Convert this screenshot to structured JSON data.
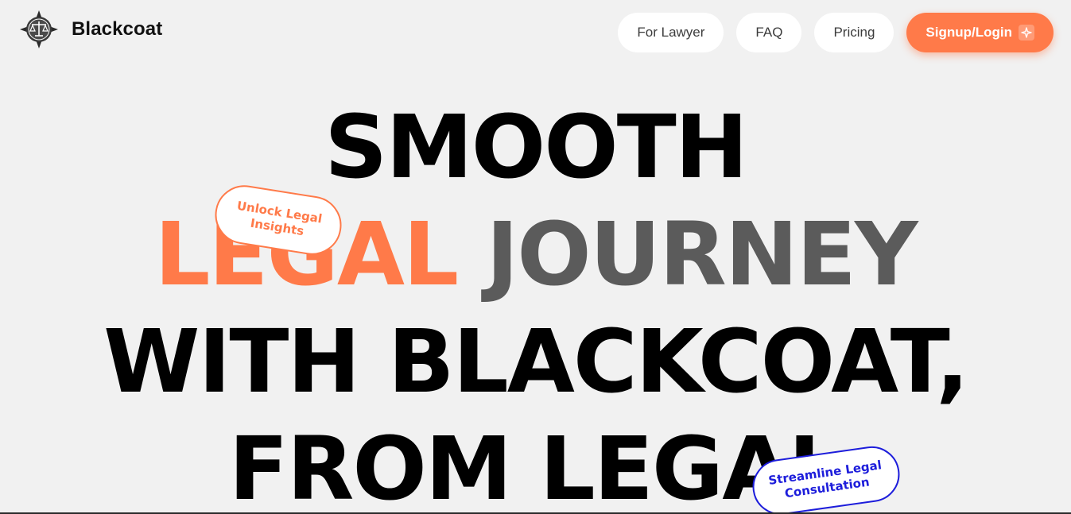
{
  "brand": {
    "name": "Blackcoat",
    "logo_icon": "scales-compass-icon"
  },
  "nav": {
    "for_lawyer": "For Lawyer",
    "faq": "FAQ",
    "pricing": "Pricing",
    "signup_login": "Signup/Login",
    "cta_icon": "sparkle-icon"
  },
  "hero": {
    "line1": "SMOOTH",
    "line2_accent": "LEGAL",
    "line2_rest": "JOURNEY",
    "line3": "WITH BLACKCOAT,",
    "line4": "FROM LEGAL"
  },
  "stickers": {
    "orange_line1": "Unlock Legal",
    "orange_line2": "Insights",
    "blue_line1": "Streamline Legal",
    "blue_line2": "Consultation"
  },
  "colors": {
    "accent": "#ff7a49",
    "sticker_blue": "#1d1ddb",
    "background": "#f1f1f1",
    "journey_gray": "#5b5b5b"
  }
}
